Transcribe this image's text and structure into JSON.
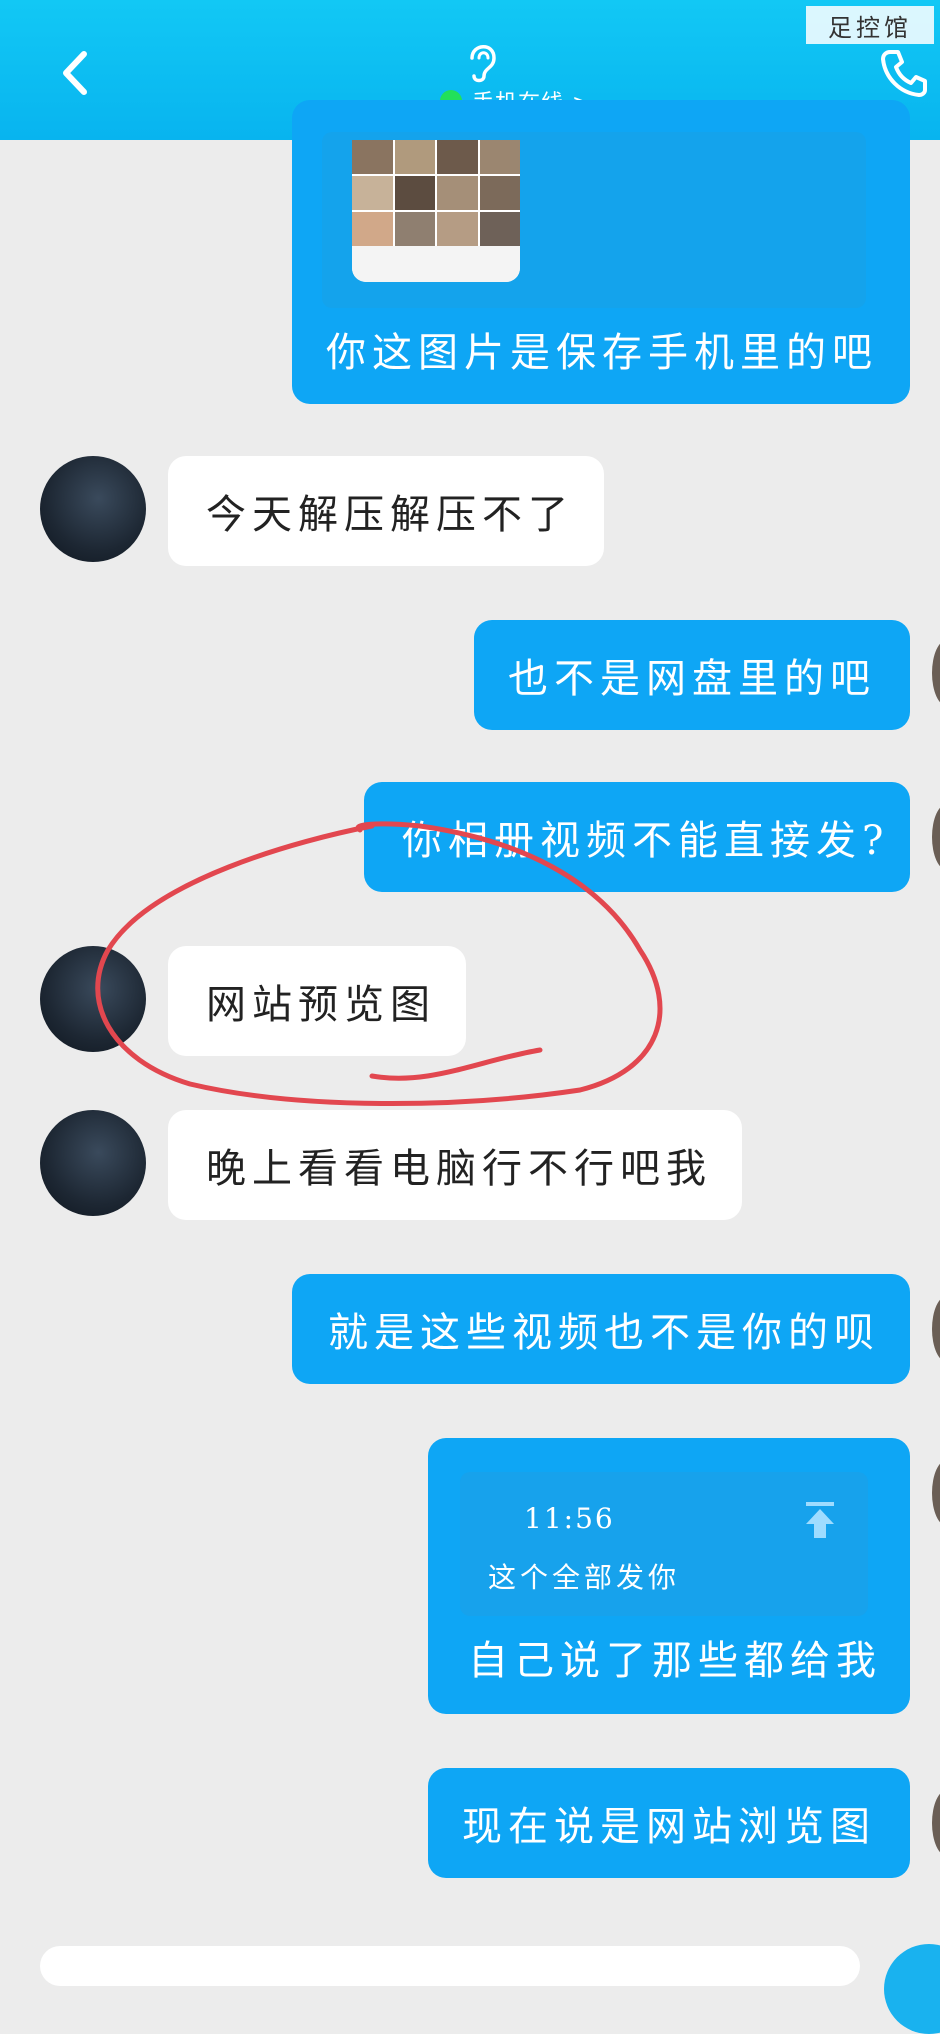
{
  "header": {
    "status_text": "手机在线 >",
    "status_color": "#22e05a",
    "background": "#0ebef2",
    "icons": [
      "chevron-left-icon",
      "ear-icon",
      "phone-icon"
    ]
  },
  "watermark": "足控馆",
  "messages": [
    {
      "side": "out",
      "text": "你这图片是保存手机里的吧"
    },
    {
      "side": "in",
      "text": "今天解压解压不了"
    },
    {
      "side": "out",
      "text": "也不是网盘里的吧"
    },
    {
      "side": "out",
      "text": "你相册视频不能直接发?"
    },
    {
      "side": "in",
      "text": "网站预览图"
    },
    {
      "side": "in",
      "text": "晚上看看电脑行不行吧我"
    },
    {
      "side": "out",
      "text": "就是这些视频也不是你的呗"
    },
    {
      "side": "out",
      "text": "自己说了那些都给我"
    },
    {
      "side": "out",
      "text": "现在说是网站浏览图"
    }
  ],
  "quote": {
    "time": "11:56",
    "text": "这个全部发你"
  },
  "colors": {
    "out_bubble": "#0ea6f5",
    "in_bubble": "#ffffff",
    "annotation": "#e2474f"
  }
}
